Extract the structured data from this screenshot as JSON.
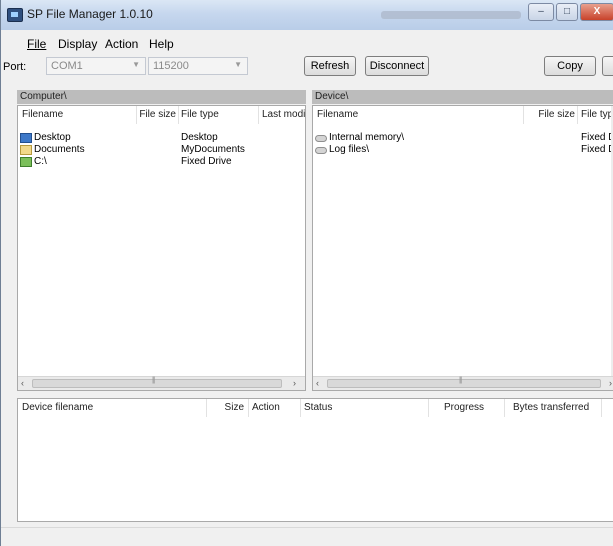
{
  "window": {
    "title": "SP File Manager 1.0.10",
    "caption_buttons": [
      "–",
      "□",
      "X"
    ]
  },
  "menu": [
    {
      "label": "File"
    },
    {
      "label": "Display"
    },
    {
      "label": "Action"
    },
    {
      "label": "Help"
    }
  ],
  "toolbar": {
    "port_label": "Port:",
    "port_value": "COM1",
    "baud_value": "115200",
    "refresh_label": "Refresh",
    "disconnect_label": "Disconnect",
    "copy_label": "Copy"
  },
  "computer_panel": {
    "path": "Computer\\",
    "columns": [
      "Filename",
      "File size",
      "File type",
      "Last modif"
    ],
    "rows": [
      {
        "name": "Desktop",
        "size": "",
        "type": "Desktop",
        "icon": "desktop-icon"
      },
      {
        "name": "Documents",
        "size": "",
        "type": "MyDocuments",
        "icon": "documents-folder-icon"
      },
      {
        "name": "C:\\",
        "size": "",
        "type": "Fixed Drive",
        "icon": "drive-icon"
      }
    ]
  },
  "device_panel": {
    "path": "Device\\",
    "columns": [
      "Filename",
      "File size",
      "File type"
    ],
    "rows": [
      {
        "name": "Internal memory\\",
        "size": "",
        "type": "Fixed Driv",
        "icon": "device-drive-icon"
      },
      {
        "name": "Log files\\",
        "size": "",
        "type": "Fixed Driv",
        "icon": "device-drive-icon"
      }
    ]
  },
  "transfer_panel": {
    "columns": [
      "Device filename",
      "Size",
      "Action",
      "Status",
      "Progress",
      "Bytes transferred"
    ]
  },
  "scroll_arrows": {
    "left": "‹",
    "right": "›"
  }
}
